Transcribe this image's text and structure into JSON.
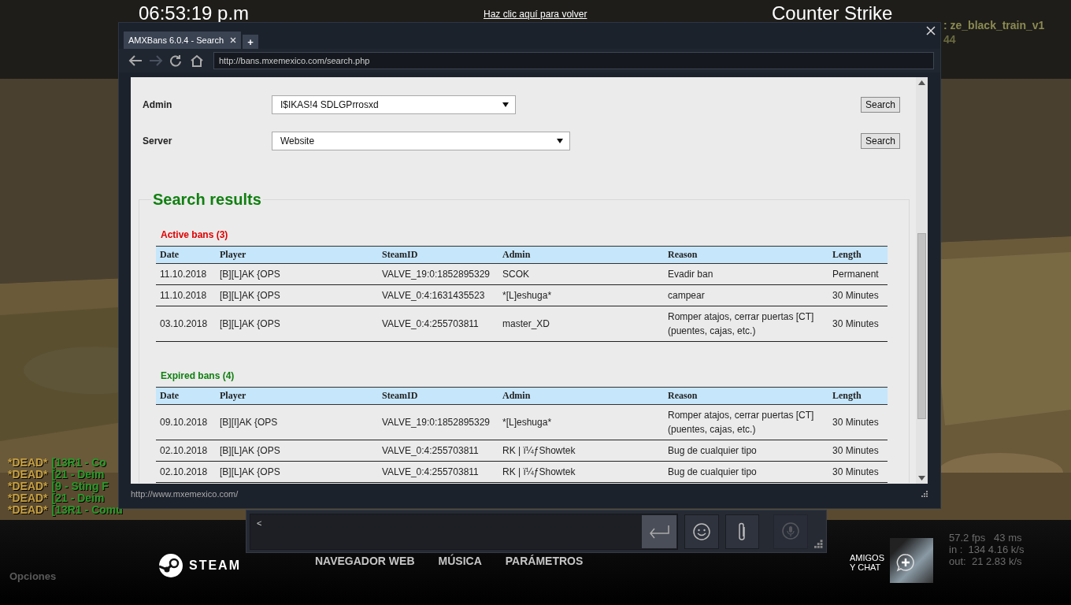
{
  "hud": {
    "clock": "06:53:19 p.m",
    "game_title": "Counter Strike",
    "return_link": "Haz clic aquí para volver",
    "map": ": ze_black_train_v1",
    "map_line_2": "44",
    "kill_feed": [
      {
        "tag": "*DEAD*",
        "name": "[13R1 - Co"
      },
      {
        "tag": "*DEAD*",
        "name": "[21 - Deim"
      },
      {
        "tag": "*DEAD*",
        "name": "[9 - Sting F"
      },
      {
        "tag": "*DEAD*",
        "name": "[21 - Deim"
      },
      {
        "tag": "*DEAD*",
        "name": "[13R1 - Comu"
      }
    ],
    "net_stats": [
      "57.2 fps   43 ms",
      "in :  134 4.16 k/s",
      "out:  21 2.83 k/s"
    ],
    "options": "Opciones"
  },
  "browser": {
    "tabs": [
      {
        "label": "AMXBans 6.0.4 - Search",
        "selected": true
      }
    ],
    "new_tab": "+",
    "url": "http://bans.mxemexico.com/search.php",
    "status_url": "http://www.mxemexico.com/",
    "filters": [
      {
        "label": "Admin",
        "value": "I$IKAS!4 SDLGPrrosxd",
        "button": "Search",
        "kind": "narrow"
      },
      {
        "label": "Server",
        "value": "Website",
        "button": "Search",
        "kind": "wide"
      }
    ],
    "results_title": "Search results",
    "sections": [
      {
        "kind": "active",
        "title": "Active bans (3)",
        "columns": [
          "Date",
          "Player",
          "SteamID",
          "Admin",
          "Reason",
          "Length"
        ],
        "rows": [
          [
            "11.10.2018",
            "[B][L]AK {OPS",
            "VALVE_19:0:1852895329",
            "SCOK",
            "Evadir ban",
            "Permanent"
          ],
          [
            "11.10.2018",
            "[B][L]AK {OPS",
            "VALVE_0:4:1631435523",
            "*[L]eshuga*",
            "campear",
            "30 Minutes"
          ],
          [
            "03.10.2018",
            "[B][L]AK {OPS",
            "VALVE_0:4:255703811",
            "master_XD",
            "Romper atajos, cerrar puertas [CT] (puentes, cajas, etc.)",
            "30 Minutes"
          ]
        ]
      },
      {
        "kind": "expired",
        "title": "Expired bans (4)",
        "columns": [
          "Date",
          "Player",
          "SteamID",
          "Admin",
          "Reason",
          "Length"
        ],
        "rows": [
          [
            "09.10.2018",
            "[B][I]AK {OPS",
            "VALVE_19:0:1852895329",
            "*[L]eshuga*",
            "Romper atajos, cerrar puertas [CT] (puentes, cajas, etc.)",
            "30 Minutes"
          ],
          [
            "02.10.2018",
            "[B][L]AK {OPS",
            "VALVE_0:4:255703811",
            "RK | ï¼ƒShowtek",
            "Bug de cualquier tipo",
            "30 Minutes"
          ],
          [
            "02.10.2018",
            "[B][L]AK {OPS",
            "VALVE_0:4:255703811",
            "RK | ï¼ƒShowtek",
            "Bug de cualquier tipo",
            "30 Minutes"
          ]
        ]
      }
    ]
  },
  "chat": {
    "input_value": "<"
  },
  "bottom_bar": {
    "logo": "STEAM",
    "nav": [
      "NAVEGADOR WEB",
      "MÚSICA",
      "PARÁMETROS"
    ],
    "friends": [
      "AMIGOS",
      "Y CHAT"
    ]
  }
}
